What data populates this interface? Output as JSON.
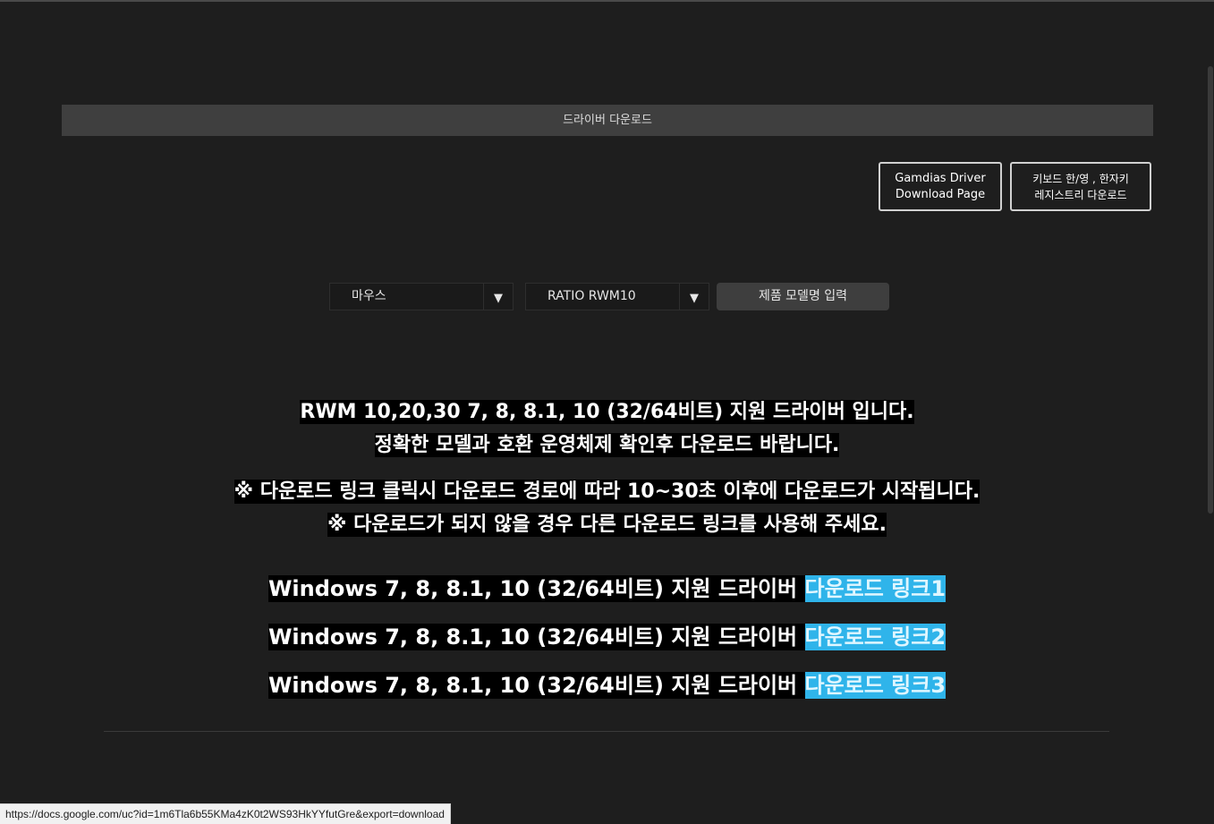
{
  "header": {
    "title": "드라이버 다운로드"
  },
  "buttons": {
    "gamdias": "Gamdias Driver\nDownload Page",
    "registry": "키보드 한/영 , 한자키\n레지스트리 다운로드",
    "model_input": "제품 모델명 입력"
  },
  "selects": {
    "category": {
      "value": "마우스",
      "arrow": "▼"
    },
    "model": {
      "value": "RATIO RWM10",
      "arrow": "▼"
    }
  },
  "notice": {
    "line1": "RWM 10,20,30 7, 8, 8.1, 10 (32/64비트) 지원 드라이버 입니다.",
    "line2": "정확한 모델과 호환 운영체제 확인후 다운로드 바랍니다.",
    "line3": "※ 다운로드 링크 클릭시 다운로드 경로에 따라 10~30초 이후에 다운로드가 시작됩니다.",
    "line4": "※ 다운로드가 되지 않을 경우 다른 다운로드 링크를 사용해 주세요."
  },
  "downloads": [
    {
      "text": "Windows 7, 8, 8.1, 10 (32/64비트) 지원 드라이버 ",
      "link": "다운로드 링크1"
    },
    {
      "text": "Windows 7, 8, 8.1, 10 (32/64비트) 지원 드라이버 ",
      "link": "다운로드 링크2"
    },
    {
      "text": "Windows 7, 8, 8.1, 10 (32/64비트) 지원 드라이버 ",
      "link": "다운로드 링크3"
    }
  ],
  "status_bar": {
    "url": "https://docs.google.com/uc?id=1m6Tla6b55KMa4zK0t2WS93HkYYfutGre&export=download"
  },
  "colors": {
    "background": "#1e1e1e",
    "header_bar": "#3f3f3f",
    "link_highlight": "#2fb4ea"
  }
}
